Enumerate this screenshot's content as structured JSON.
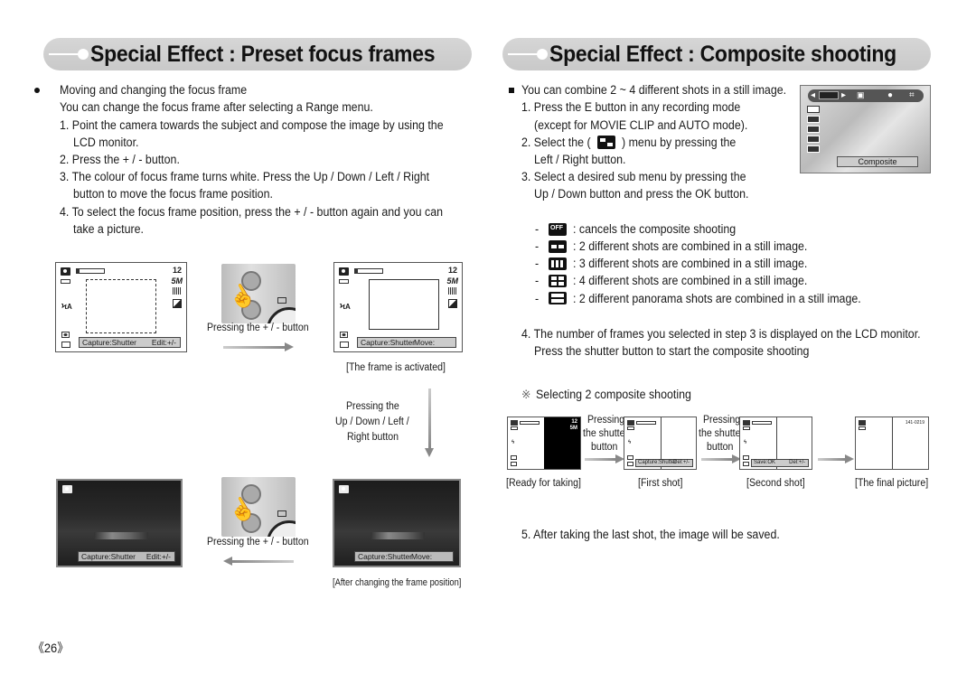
{
  "left": {
    "header": "Special Effect : Preset focus frames",
    "bullet": "Moving and changing the focus frame",
    "intro": "You can change the focus frame after selecting a Range menu.",
    "steps": [
      {
        "line1": "1. Point the camera towards the subject and compose the image by using the",
        "line2": "LCD monitor."
      },
      {
        "line1": "2. Press the + / - button."
      },
      {
        "line1": "3. The colour of focus frame turns white. Press the Up / Down / Left / Right",
        "line2": "button to move the focus frame position."
      },
      {
        "line1": "4. To select the focus frame position, press the + / - button again and you can",
        "line2": "take a picture."
      }
    ],
    "lcd": {
      "count": "12",
      "resolution": "5M",
      "flash": "ϞA",
      "status_capture": "Capture:Shutter",
      "status_edit": "Edit:+/-",
      "status_move": "Move:"
    },
    "pressing_pm": "Pressing the + / - button",
    "frame_activated": "[The frame is activated]",
    "pressing_dir": [
      "Pressing the",
      "Up / Down / Left /",
      "Right button"
    ],
    "after_changing": "[After changing the frame position]"
  },
  "right": {
    "header": "Special Effect : Composite shooting",
    "intro": "You can combine 2 ~ 4 different shots in a still image.",
    "steps": [
      {
        "line1": "1. Press the E button in any recording mode",
        "line2": "(except for MOVIE CLIP and AUTO mode)."
      },
      {
        "line1a": "2. Select the (",
        "line1b": ") menu by pressing the",
        "line2": "Left / Right button."
      },
      {
        "line1": "3. Select a desired sub menu by pressing the",
        "line2": "Up / Down button and press the OK button."
      }
    ],
    "menu_label": "Composite",
    "options": [
      {
        "icon": "off-icon",
        "text": ": cancels the composite shooting"
      },
      {
        "icon": "two-shots-icon",
        "text": ": 2 different shots are combined in a still image."
      },
      {
        "icon": "three-shots-icon",
        "text": ": 3 different shots are combined in a still image."
      },
      {
        "icon": "four-shots-icon",
        "text": ": 4 different shots are combined in a still image."
      },
      {
        "icon": "panorama-icon",
        "text": ": 2 different panorama shots are combined in a still image."
      }
    ],
    "step4": {
      "line1": "4. The number of frames you selected in step 3 is displayed on the LCD monitor.",
      "line2": "Press the shutter button to start the composite shooting"
    },
    "note_mark": "※",
    "note": "Selecting 2 composite shooting",
    "sequence": {
      "pressing": [
        "Pressing",
        "the shutter",
        "button"
      ],
      "captions": [
        "[Ready for taking]",
        "[First shot]",
        "[Second shot]",
        "[The final picture]"
      ],
      "first_status": {
        "left": "Capture:Shutter",
        "right": "Del:+/-"
      },
      "second_status": {
        "left": "Save:OK",
        "right": "Del:+/-"
      },
      "count": "12",
      "res": "5M",
      "file_no": "141-0219"
    },
    "step5": "5. After taking the last shot, the image will be saved."
  },
  "page_number": "《26》"
}
